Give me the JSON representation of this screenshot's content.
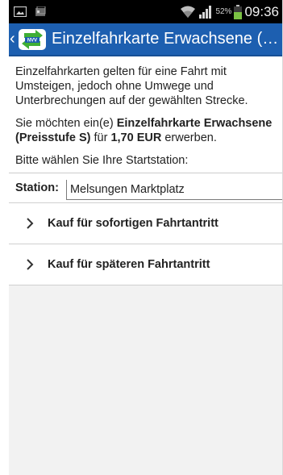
{
  "status_bar": {
    "battery_percent": "52%",
    "time": "09:36"
  },
  "title_bar": {
    "logo_text": "NVV",
    "title": "Einzelfahrkarte Erwachsene (Pr..."
  },
  "content": {
    "intro": "Einzelfahrkarten gelten für eine Fahrt mit Umsteigen, jedoch ohne Umwege und Unterbrechungen auf der gewählten Strecke.",
    "purchase": {
      "prefix": "Sie möchten ein(e) ",
      "ticket": "Einzelfahrkarte Erwachsene (Preisstufe S)",
      "mid": " für ",
      "price": "1,70 EUR",
      "suffix": " erwerben."
    },
    "instruction": "Bitte wählen Sie Ihre Startstation:",
    "station": {
      "label": "Station:",
      "value": "Melsungen Marktplatz"
    }
  },
  "actions": [
    {
      "label": "Kauf für sofortigen Fahrtantritt"
    },
    {
      "label": "Kauf für späteren Fahrtantritt"
    }
  ],
  "colors": {
    "title_bar": "#1d5fb0",
    "logo_green": "#3fae35",
    "background": "#f2f2f2"
  }
}
